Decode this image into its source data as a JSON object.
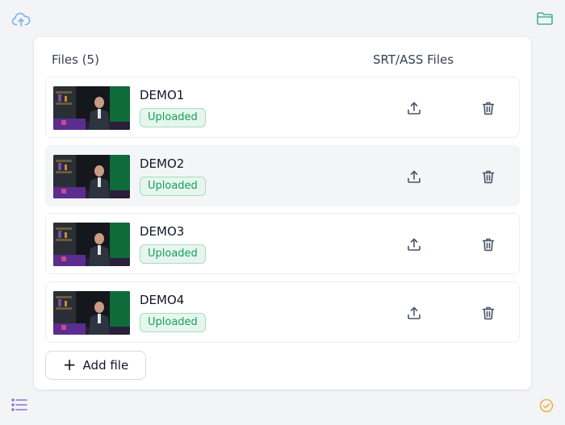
{
  "header": {
    "files_label": "Files (5)",
    "srt_label": "SRT/ASS Files"
  },
  "files": [
    {
      "name": "DEMO1",
      "status": "Uploaded"
    },
    {
      "name": "DEMO2",
      "status": "Uploaded"
    },
    {
      "name": "DEMO3",
      "status": "Uploaded"
    },
    {
      "name": "DEMO4",
      "status": "Uploaded"
    }
  ],
  "add_button": {
    "label": "Add file"
  },
  "icons": {
    "top_left": "cloud-upload-icon",
    "top_right": "folder-icon",
    "bottom_left": "list-icon",
    "bottom_right": "check-circle-icon",
    "row_upload": "upload-icon",
    "row_delete": "trash-icon"
  },
  "colors": {
    "accent_blue": "#7fb3e6",
    "accent_green": "#3fb68b",
    "accent_purple": "#8b6fd6",
    "accent_amber": "#e8b54a",
    "badge_text": "#16a05a",
    "badge_bg": "#e6f6ee"
  }
}
